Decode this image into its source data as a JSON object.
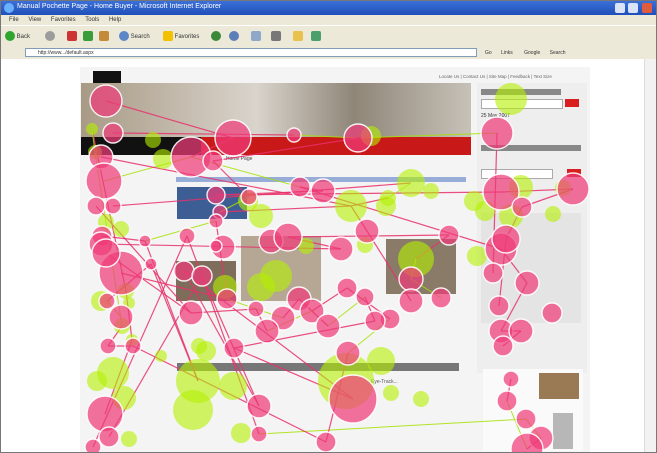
{
  "window": {
    "title": "Manual Pochette Page - Home Buyer - Microsoft Internet Explorer"
  },
  "menu": [
    "File",
    "View",
    "Favorites",
    "Tools",
    "Help"
  ],
  "toolbar": {
    "back": "Back",
    "search": "Search",
    "favorites": "Favorites"
  },
  "address": {
    "url": "http://www.../default.aspx",
    "go": "Go",
    "links": "Links",
    "google": "Google",
    "search": "Search"
  },
  "page": {
    "top_links": "Locate Us | Contact Us | Site Map | Feedback | Text Size",
    "breadcrumb": "Home Page",
    "promo_heading": "Eye-Track...",
    "sidebar_date": "25 May 2007"
  },
  "colors": {
    "titlebar": "#2452c6",
    "chrome": "#ece9d8",
    "fixation_hot": "#ee3c78",
    "fixation_green": "#b4f000",
    "page_red": "#c81818"
  },
  "icons": [
    "ie-icon",
    "back-icon",
    "search-icon",
    "favorites-icon",
    "home-icon",
    "print-icon",
    "mail-icon",
    "go-icon"
  ]
}
